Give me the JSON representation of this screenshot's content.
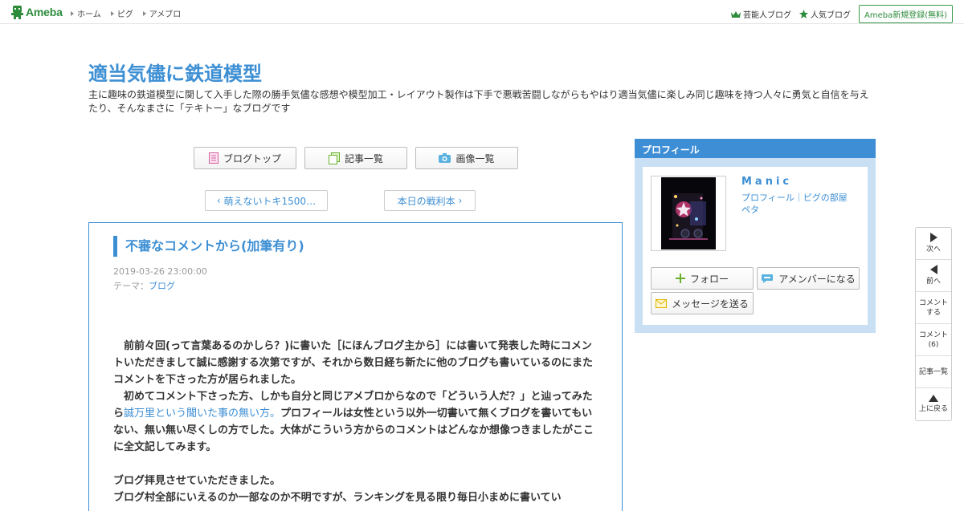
{
  "topbar": {
    "logo": "Ameba",
    "nav": [
      "ホーム",
      "ピグ",
      "アメブロ"
    ],
    "celeb_blog": "芸能人ブログ",
    "popular_blog": "人気ブログ",
    "register": "Ameba新規登録(無料)"
  },
  "header": {
    "title": "適当気儘に鉄道模型",
    "description": "主に趣味の鉄道模型に関して入手した際の勝手気儘な感想や模型加工・レイアウト製作は下手で悪戦苦闘しながらもやはり適当気儘に楽しみ同じ趣味を持つ人々に勇気と自信を与えたり、そんなまさに「テキトー」なブログです"
  },
  "navbuttons": {
    "blog_top": "ブログトップ",
    "articles": "記事一覧",
    "images": "画像一覧"
  },
  "pager": {
    "prev": "萌えないトキ1500…",
    "next": "本日の戦利本"
  },
  "article": {
    "title": "不審なコメントから(加筆有り)",
    "date": "2019-03-26 23:00:00",
    "theme_label": "テーマ：",
    "theme": "ブログ",
    "p1": "　前前々回(って言葉あるのかしら？)に書いた［にほんブログ主から］には書いて発表した時にコメントいただきまして誠に感謝する次第ですが、それから数日経ち新たに他のブログも書いているのにまたコメントを下さった方が居られました。",
    "p2a": "　初めてコメント下さった方、しかも自分と同じアメブロからなので「どういう人だ？」と辿ってみたら",
    "p2_link": "誠万里という聞いた事の無い方。",
    "p2b": "プロフィールは女性という以外一切書いて無くブログを書いてもいない、無い無い尽くしの方でした。大体がこういう方からのコメントはどんなか想像つきましたがここに全文記してみます。",
    "p3": "ブログ拝見させていただきました。",
    "p4": "ブログ村全部にいえるのか一部なのか不明ですが、ランキングを見る限り毎日小まめに書いてい"
  },
  "profile": {
    "heading": "プロフィール",
    "name": "Manic",
    "link_profile": "プロフィール",
    "link_pig": "ピグの部屋",
    "link_peta": "ペタ",
    "follow": "フォロー",
    "amember": "アメンバーになる",
    "message": "メッセージを送る"
  },
  "sidetool": {
    "next": "次へ",
    "prev": "前へ",
    "comment_do_1": "コメント",
    "comment_do_2": "する",
    "comments_1": "コメント",
    "comments_2": "(6)",
    "article_list": "記事一覧",
    "to_top": "上に戻る"
  },
  "colors": {
    "accent_blue": "#3d8fd4",
    "ameba_green": "#2d8c3c",
    "profile_bg": "#c9dff4"
  }
}
